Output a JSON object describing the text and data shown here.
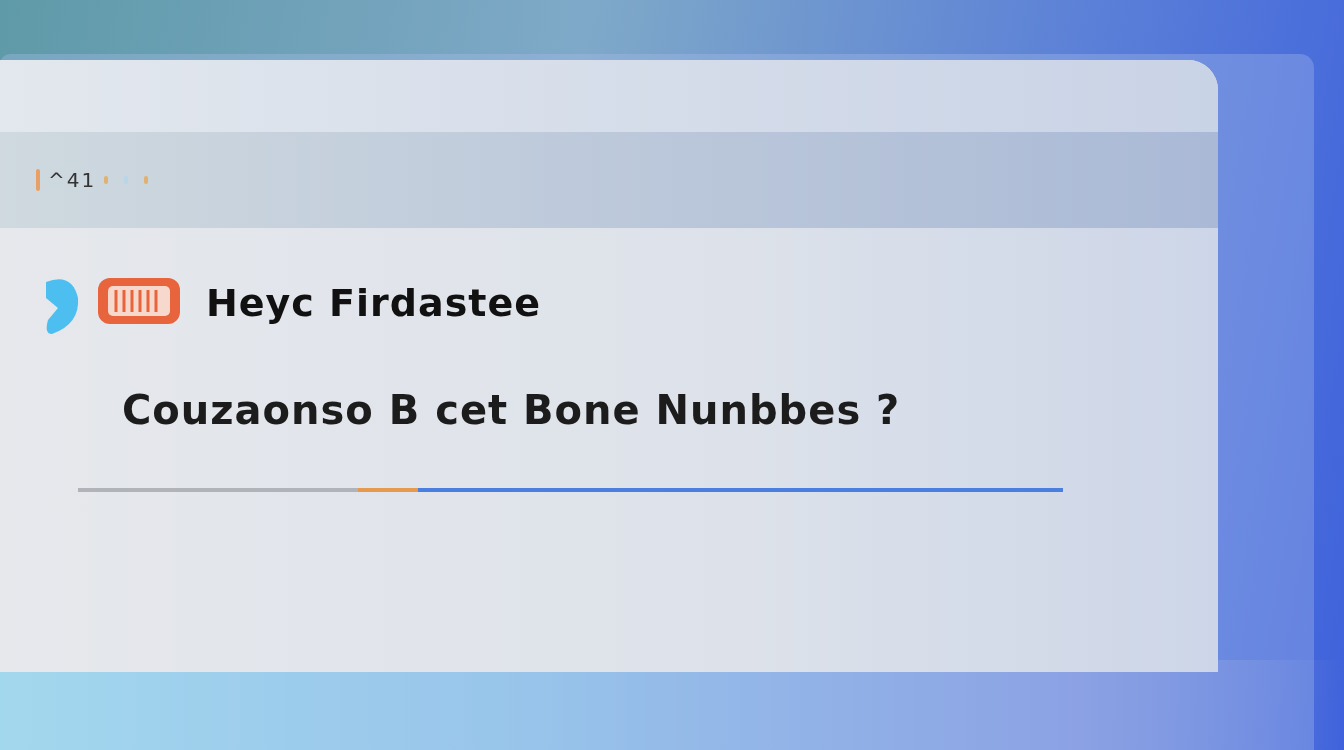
{
  "header": {
    "label": "^41"
  },
  "card": {
    "title": "Heyc Firdastee",
    "question": "Couzaonso B cet Bone  Nunbbes ?"
  }
}
